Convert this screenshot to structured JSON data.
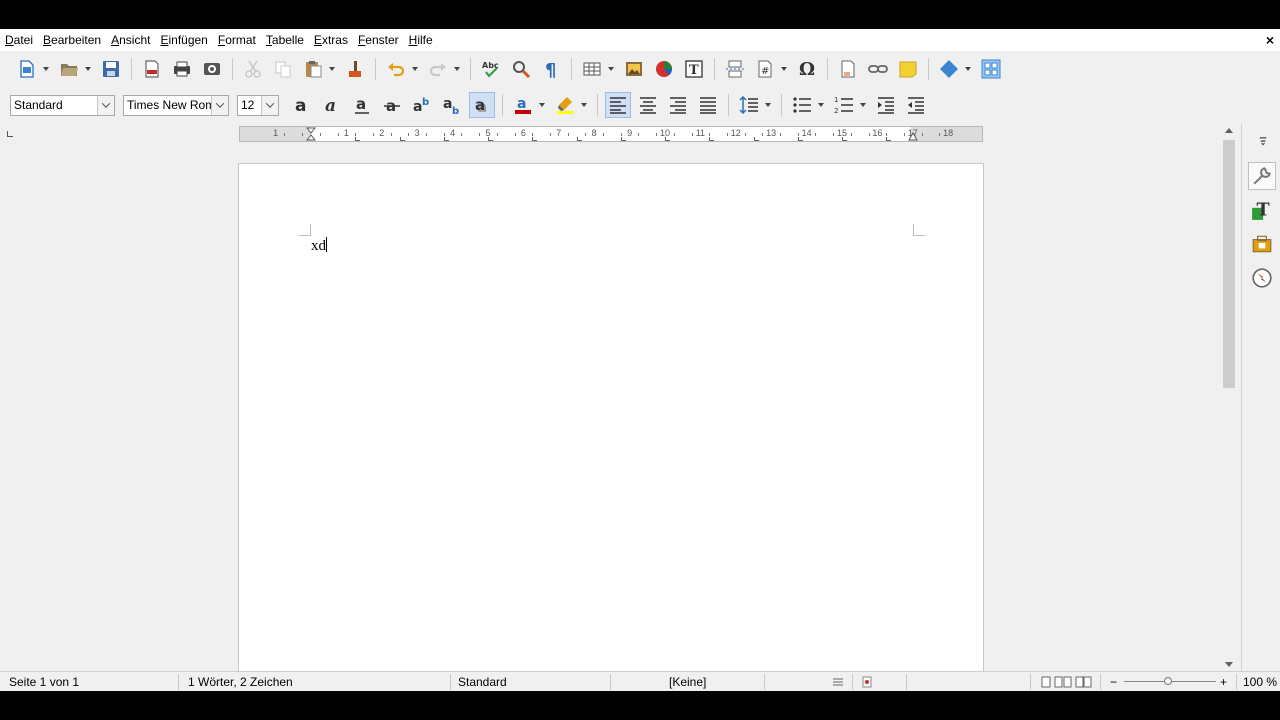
{
  "menu": [
    "Datei",
    "Bearbeiten",
    "Ansicht",
    "Einfügen",
    "Format",
    "Tabelle",
    "Extras",
    "Fenster",
    "Hilfe"
  ],
  "menu_close": "×",
  "format_toolbar": {
    "paragraph_style": "Standard",
    "font_name": "Times New Roman",
    "font_size": "12"
  },
  "ruler": {
    "numbers": [
      "1",
      "1",
      "2",
      "3",
      "4",
      "5",
      "6",
      "7",
      "8",
      "9",
      "10",
      "11",
      "12",
      "13",
      "14",
      "15",
      "16",
      "17",
      "18"
    ]
  },
  "document": {
    "text": "xd"
  },
  "status": {
    "page": "Seite 1 von 1",
    "words": "1 Wörter, 2 Zeichen",
    "page_style": "Standard",
    "language": "[Keine]",
    "zoom_minus": "−",
    "zoom_plus": "+",
    "zoom": "100 %"
  },
  "colors": {
    "accent": "#2a6ebb",
    "font_color": "#c00000",
    "highlight": "#ffff00"
  }
}
